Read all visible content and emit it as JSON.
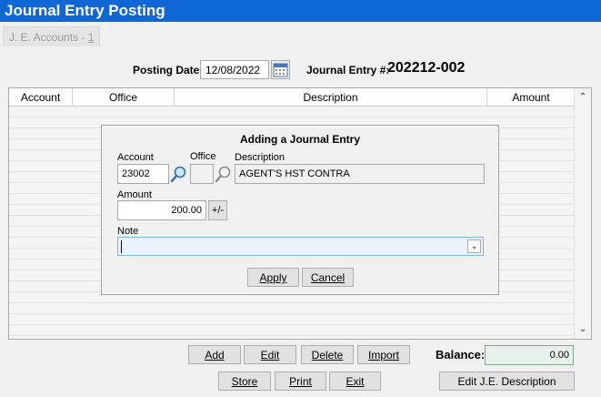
{
  "window": {
    "title": "Journal Entry Posting"
  },
  "tab": {
    "label_prefix": "J. E. Accounts - ",
    "label_count": "1"
  },
  "header": {
    "posting_date_label": "Posting Date:",
    "posting_date_value": "12/08/2022",
    "journal_entry_label": "Journal Entry #:",
    "journal_entry_value": "202212-002"
  },
  "grid": {
    "columns": [
      "Account",
      "Office",
      "Description",
      "Amount"
    ]
  },
  "dialog": {
    "title": "Adding a Journal Entry",
    "account_label": "Account",
    "account_value": "23002",
    "office_label": "Office",
    "office_value": "",
    "description_label": "Description",
    "description_value": "AGENT'S HST CONTRA",
    "amount_label": "Amount",
    "amount_value": "200.00",
    "sign_button": "+/-",
    "note_label": "Note",
    "note_value": "",
    "apply_button": "Apply",
    "cancel_button": "Cancel"
  },
  "actions": {
    "add": "Add",
    "edit": "Edit",
    "delete": "Delete",
    "import": "Import",
    "store": "Store",
    "print": "Print",
    "exit": "Exit",
    "edit_je_description": "Edit J.E. Description"
  },
  "balance": {
    "label": "Balance:",
    "value": "0.00"
  },
  "colors": {
    "title_bar": "#0f67d6",
    "note_focus": "#7eb4ea",
    "balance_border": "#7fa78a"
  },
  "icons": {
    "calendar": "calendar-icon",
    "lookup": "magnifier-icon",
    "dropdown": "chevron-down-icon"
  }
}
